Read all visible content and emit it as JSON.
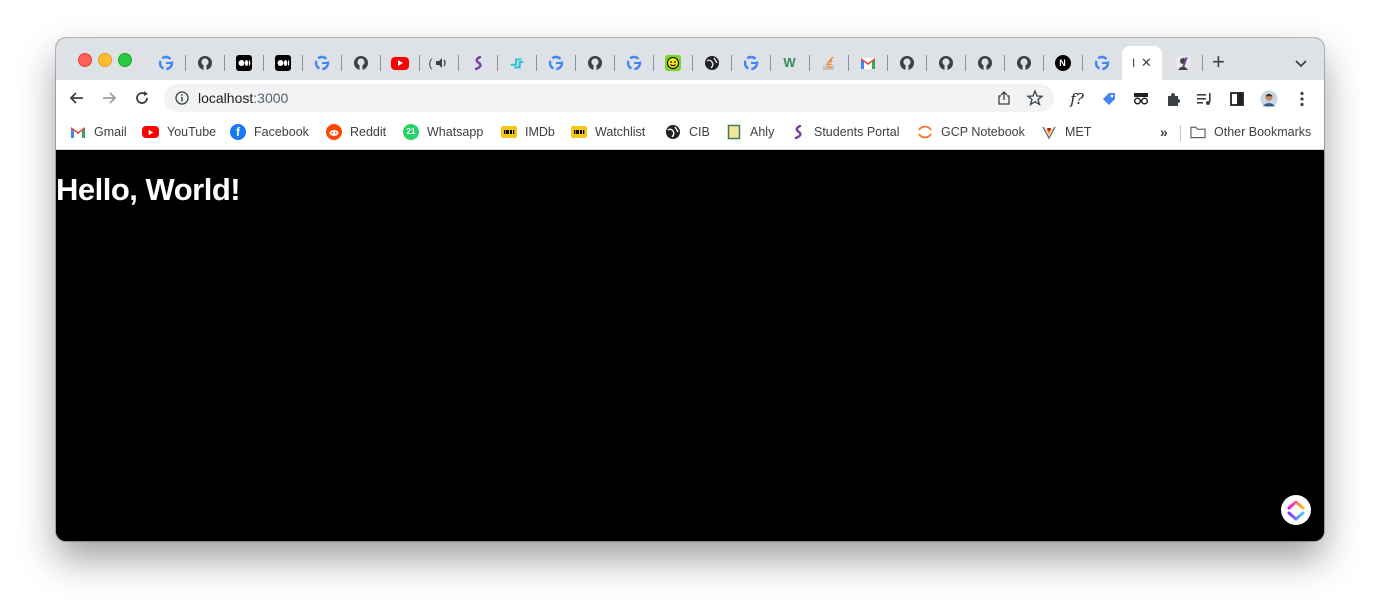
{
  "window": {
    "colors": {
      "titlebar": "#dee1e6",
      "page_bg": "#000000"
    }
  },
  "tabs": [
    {
      "icon": "google-icon"
    },
    {
      "icon": "github-icon"
    },
    {
      "icon": "medium-icon"
    },
    {
      "icon": "medium-icon"
    },
    {
      "icon": "google-icon"
    },
    {
      "icon": "github-icon"
    },
    {
      "icon": "youtube-icon"
    },
    {
      "icon": "audio-playing-icon",
      "label": "("
    },
    {
      "icon": "students-portal-icon"
    },
    {
      "icon": "flow-icon"
    },
    {
      "icon": "google-icon"
    },
    {
      "icon": "github-icon"
    },
    {
      "icon": "google-icon"
    },
    {
      "icon": "smiley-icon"
    },
    {
      "icon": "globe-icon"
    },
    {
      "icon": "google-icon"
    },
    {
      "icon": "w-icon"
    },
    {
      "icon": "stackoverflow-icon"
    },
    {
      "icon": "gmail-icon"
    },
    {
      "icon": "github-icon"
    },
    {
      "icon": "github-icon"
    },
    {
      "icon": "github-icon"
    },
    {
      "icon": "github-icon"
    },
    {
      "icon": "nextjs-icon"
    },
    {
      "icon": "google-icon"
    },
    {
      "icon": "page-icon",
      "label": "l",
      "active": true
    },
    {
      "icon": "avatar-icon"
    }
  ],
  "address_bar": {
    "host": "localhost",
    "port": ":3000"
  },
  "extensions": [
    {
      "icon": "fx-icon",
      "label": "f?"
    },
    {
      "icon": "tag-icon"
    },
    {
      "icon": "incognito-icon"
    },
    {
      "icon": "puzzle-icon"
    },
    {
      "icon": "playlist-icon"
    },
    {
      "icon": "sidepanel-icon"
    },
    {
      "icon": "profile-avatar-icon"
    },
    {
      "icon": "kebab-menu-icon"
    }
  ],
  "bookmarks": [
    {
      "label": "Gmail",
      "icon": "gmail-icon"
    },
    {
      "label": "YouTube",
      "icon": "youtube-icon"
    },
    {
      "label": "Facebook",
      "icon": "facebook-icon"
    },
    {
      "label": "Reddit",
      "icon": "reddit-icon"
    },
    {
      "label": "Whatsapp",
      "icon": "whatsapp-icon",
      "badge": "21"
    },
    {
      "label": "IMDb",
      "icon": "imdb-icon"
    },
    {
      "label": "Watchlist",
      "icon": "imdb-icon"
    },
    {
      "label": "CIB",
      "icon": "globe-icon"
    },
    {
      "label": "Ahly",
      "icon": "ahly-icon"
    },
    {
      "label": "Students Portal",
      "icon": "students-portal-icon"
    },
    {
      "label": "GCP Notebook",
      "icon": "gcp-icon"
    },
    {
      "label": "MET",
      "icon": "met-icon"
    }
  ],
  "bookmarks_overflow": "»",
  "other_bookmarks": {
    "label": "Other Bookmarks",
    "icon": "folder-icon"
  },
  "page": {
    "heading": "Hello, World!"
  },
  "floating_widget": {
    "icon": "clickup-icon"
  }
}
